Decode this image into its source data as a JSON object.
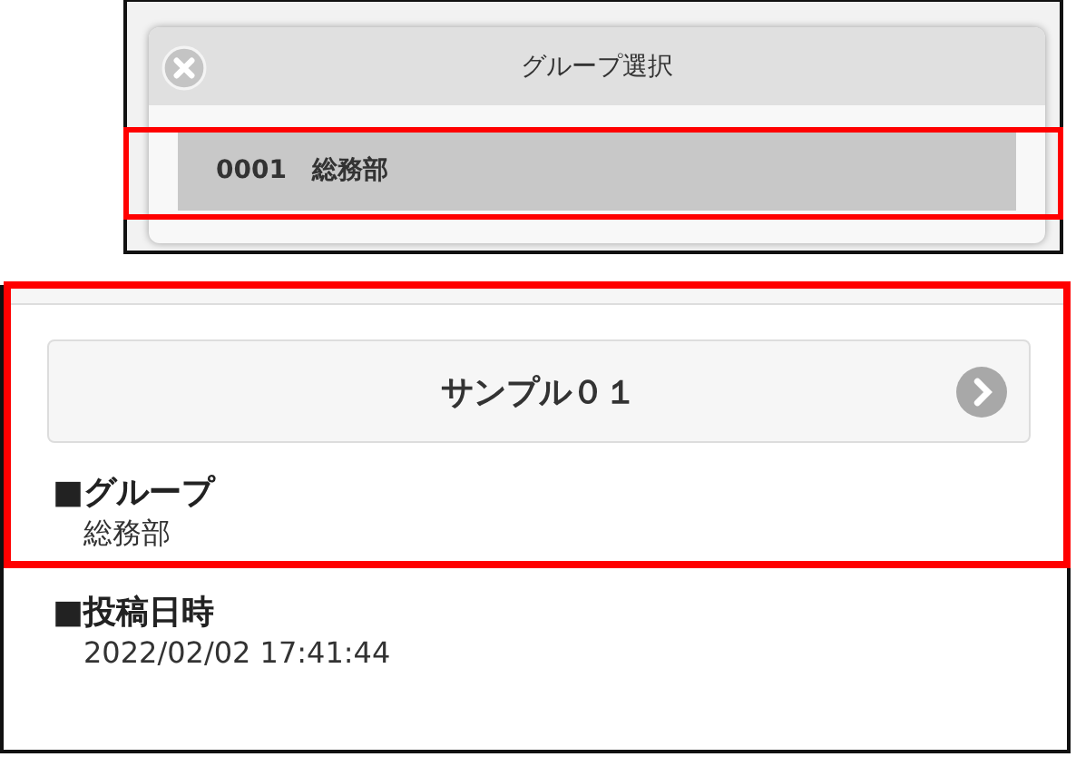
{
  "dialog": {
    "title": "グループ選択",
    "rows": [
      {
        "code": "0001",
        "name": "総務部",
        "selected": true,
        "highlighted": true
      }
    ]
  },
  "detail": {
    "item_title": "サンプル０１",
    "fields": [
      {
        "label": "■グループ",
        "value": "総務部",
        "highlighted": true
      },
      {
        "label": "■投稿日時",
        "value": "2022/02/02 17:41:44",
        "highlighted": false
      }
    ]
  }
}
